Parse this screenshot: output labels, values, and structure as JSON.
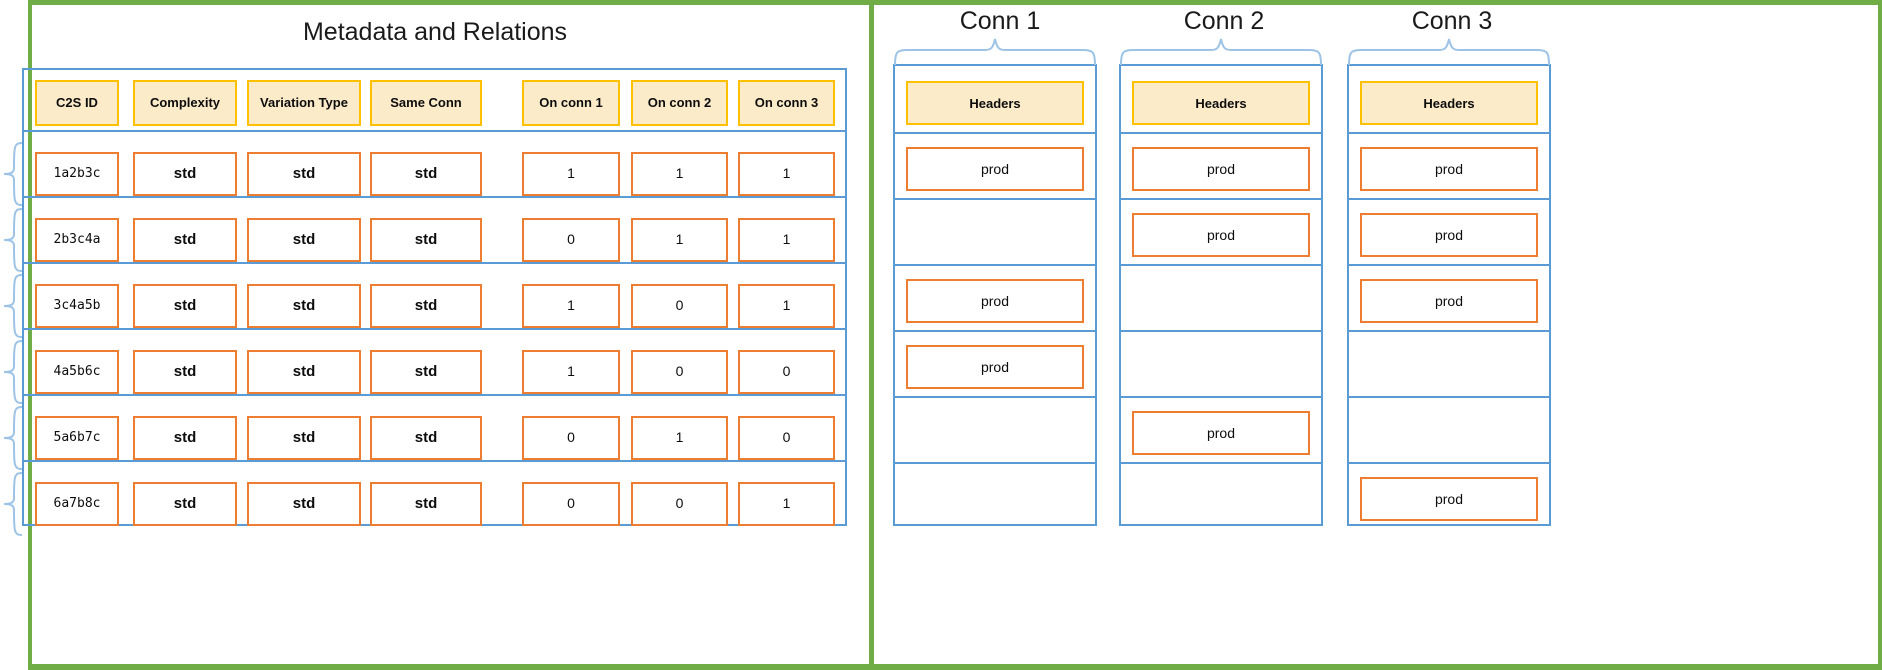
{
  "colors": {
    "frame_green": "#70AD47",
    "outline_blue": "#5B9BD5",
    "header_fill": "#FCEBC9",
    "header_border": "#FFC000",
    "cell_border": "#ED7D31",
    "text": "#0d0d0d",
    "background": "#ffffff"
  },
  "left_panel": {
    "title": "Metadata and Relations",
    "columns": [
      {
        "label": "C2S ID",
        "group": "meta"
      },
      {
        "label": "Complexity",
        "group": "meta"
      },
      {
        "label": "Variation Type",
        "group": "meta"
      },
      {
        "label": "Same Conn",
        "group": "meta"
      },
      {
        "label": "On conn 1",
        "group": "conn"
      },
      {
        "label": "On conn 2",
        "group": "conn"
      },
      {
        "label": "On conn 3",
        "group": "conn"
      }
    ],
    "rows": [
      {
        "id": "1a2b3c",
        "complexity": "std",
        "variation_type": "std",
        "same_conn": "std",
        "on_conn_1": "1",
        "on_conn_2": "1",
        "on_conn_3": "1"
      },
      {
        "id": "2b3c4a",
        "complexity": "std",
        "variation_type": "std",
        "same_conn": "std",
        "on_conn_1": "0",
        "on_conn_2": "1",
        "on_conn_3": "1"
      },
      {
        "id": "3c4a5b",
        "complexity": "std",
        "variation_type": "std",
        "same_conn": "std",
        "on_conn_1": "1",
        "on_conn_2": "0",
        "on_conn_3": "1"
      },
      {
        "id": "4a5b6c",
        "complexity": "std",
        "variation_type": "std",
        "same_conn": "std",
        "on_conn_1": "1",
        "on_conn_2": "0",
        "on_conn_3": "0"
      },
      {
        "id": "5a6b7c",
        "complexity": "std",
        "variation_type": "std",
        "same_conn": "std",
        "on_conn_1": "0",
        "on_conn_2": "1",
        "on_conn_3": "0"
      },
      {
        "id": "6a7b8c",
        "complexity": "std",
        "variation_type": "std",
        "same_conn": "std",
        "on_conn_1": "0",
        "on_conn_2": "0",
        "on_conn_3": "1"
      }
    ]
  },
  "right_panel": {
    "connections": [
      {
        "title": "Conn 1",
        "header": "Headers",
        "cells": [
          "prod",
          "",
          "prod",
          "prod",
          "",
          ""
        ]
      },
      {
        "title": "Conn 2",
        "header": "Headers",
        "cells": [
          "prod",
          "prod",
          "",
          "",
          "prod",
          ""
        ]
      },
      {
        "title": "Conn 3",
        "header": "Headers",
        "cells": [
          "prod",
          "prod",
          "prod",
          "",
          "",
          "prod"
        ]
      }
    ]
  }
}
